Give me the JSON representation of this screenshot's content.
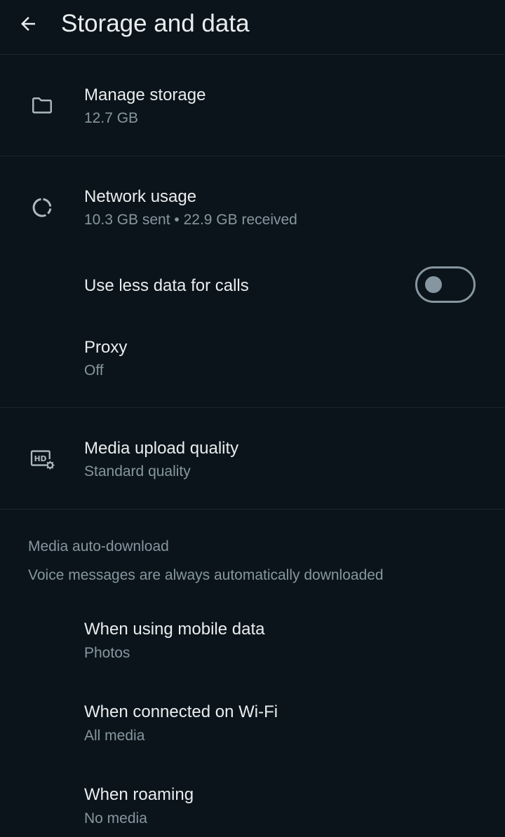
{
  "appbar": {
    "title": "Storage and data",
    "back_icon": "arrow-left-icon"
  },
  "manage_storage": {
    "title": "Manage storage",
    "subtitle": "12.7 GB",
    "icon": "folder-icon"
  },
  "network_usage": {
    "title": "Network usage",
    "subtitle": "10.3 GB sent • 22.9 GB received",
    "icon": "data-usage-icon"
  },
  "less_data_calls": {
    "title": "Use less data for calls",
    "enabled": false
  },
  "proxy": {
    "title": "Proxy",
    "subtitle": "Off"
  },
  "media_upload": {
    "title": "Media upload quality",
    "subtitle": "Standard quality",
    "icon": "hd-settings-icon"
  },
  "auto_download": {
    "header": "Media auto-download",
    "note": "Voice messages are always automatically downloaded",
    "items": [
      {
        "title": "When using mobile data",
        "subtitle": "Photos"
      },
      {
        "title": "When connected on Wi-Fi",
        "subtitle": "All media"
      },
      {
        "title": "When roaming",
        "subtitle": "No media"
      }
    ]
  },
  "colors": {
    "background": "#0b141a",
    "text_primary": "#e9edef",
    "text_secondary": "#8696a0",
    "divider": "#1c262d"
  }
}
